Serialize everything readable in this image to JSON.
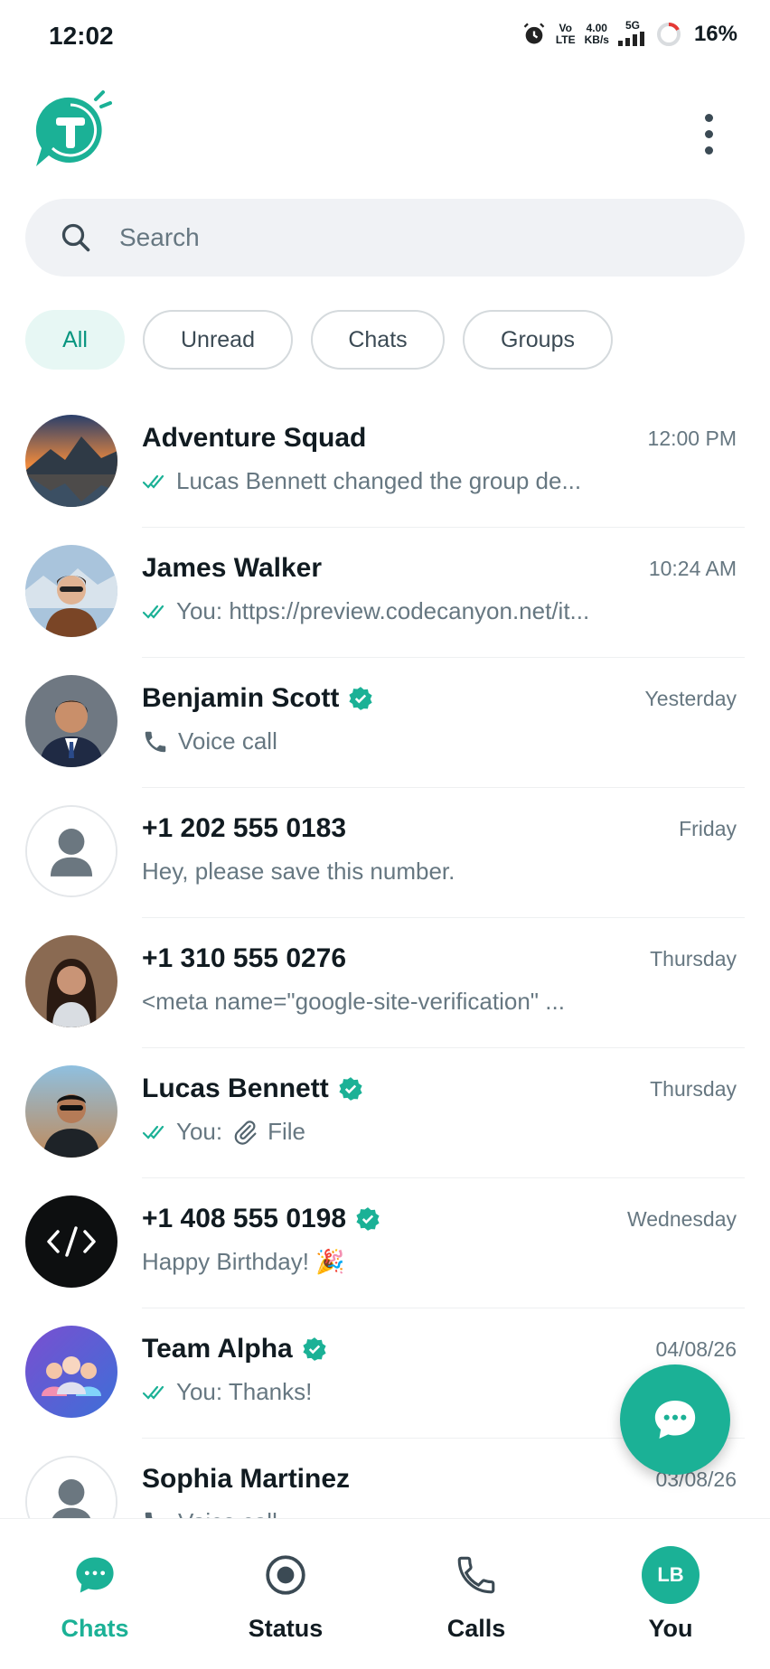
{
  "status_bar": {
    "time": "12:02",
    "net_top": "Vo",
    "net_bottom": "LTE",
    "speed_top": "4.00",
    "speed_bottom": "KB/s",
    "gen": "5G",
    "battery": "16%"
  },
  "search": {
    "placeholder": "Search"
  },
  "filters": [
    {
      "label": "All",
      "active": true
    },
    {
      "label": "Unread",
      "active": false
    },
    {
      "label": "Chats",
      "active": false
    },
    {
      "label": "Groups",
      "active": false
    }
  ],
  "chats": [
    {
      "name": "Adventure Squad",
      "time": "12:00 PM",
      "preview": "Lucas Bennett changed the group de...",
      "read_ticks": true,
      "verified": false,
      "avatar": "mountain-lake-photo"
    },
    {
      "name": "James Walker",
      "time": "10:24 AM",
      "preview": "You: https://preview.codecanyon.net/it...",
      "read_ticks": true,
      "verified": false,
      "avatar": "man-mountains-photo"
    },
    {
      "name": "Benjamin Scott",
      "time": "Yesterday",
      "preview": "Voice call",
      "read_ticks": false,
      "verified": true,
      "avatar": "man-suit-photo",
      "preview_icon": "phone-icon"
    },
    {
      "name": "+1 202 555 0183",
      "time": "Friday",
      "preview": "Hey, please save this number.",
      "read_ticks": false,
      "verified": false,
      "avatar": "default-person-icon"
    },
    {
      "name": "+1 310 555 0276",
      "time": "Thursday",
      "preview": "<meta name=\"google-site-verification\" ...",
      "read_ticks": false,
      "verified": false,
      "avatar": "woman-photo"
    },
    {
      "name": "Lucas Bennett",
      "time": "Thursday",
      "preview_prefix": "You:",
      "preview": "File",
      "read_ticks": true,
      "verified": true,
      "avatar": "man-city-photo",
      "preview_icon": "paperclip-icon"
    },
    {
      "name": "+1 408 555 0198",
      "time": "Wednesday",
      "preview": "Happy Birthday! 🎉",
      "read_ticks": false,
      "verified": true,
      "avatar": "code-icon"
    },
    {
      "name": "Team Alpha",
      "time": "04/08/26",
      "preview": "You: Thanks!",
      "read_ticks": true,
      "verified": true,
      "avatar": "team-group-icon"
    },
    {
      "name": "Sophia Martinez",
      "time": "03/08/26",
      "preview": "Voice call",
      "read_ticks": false,
      "verified": false,
      "avatar": "default-person-icon",
      "preview_icon": "phone-icon"
    }
  ],
  "nav": {
    "chats": "Chats",
    "status": "Status",
    "calls": "Calls",
    "you": "You",
    "you_initials": "LB"
  },
  "colors": {
    "accent": "#1bb196",
    "chip_active_bg": "#e7f7f4",
    "secondary_text": "#667781"
  }
}
